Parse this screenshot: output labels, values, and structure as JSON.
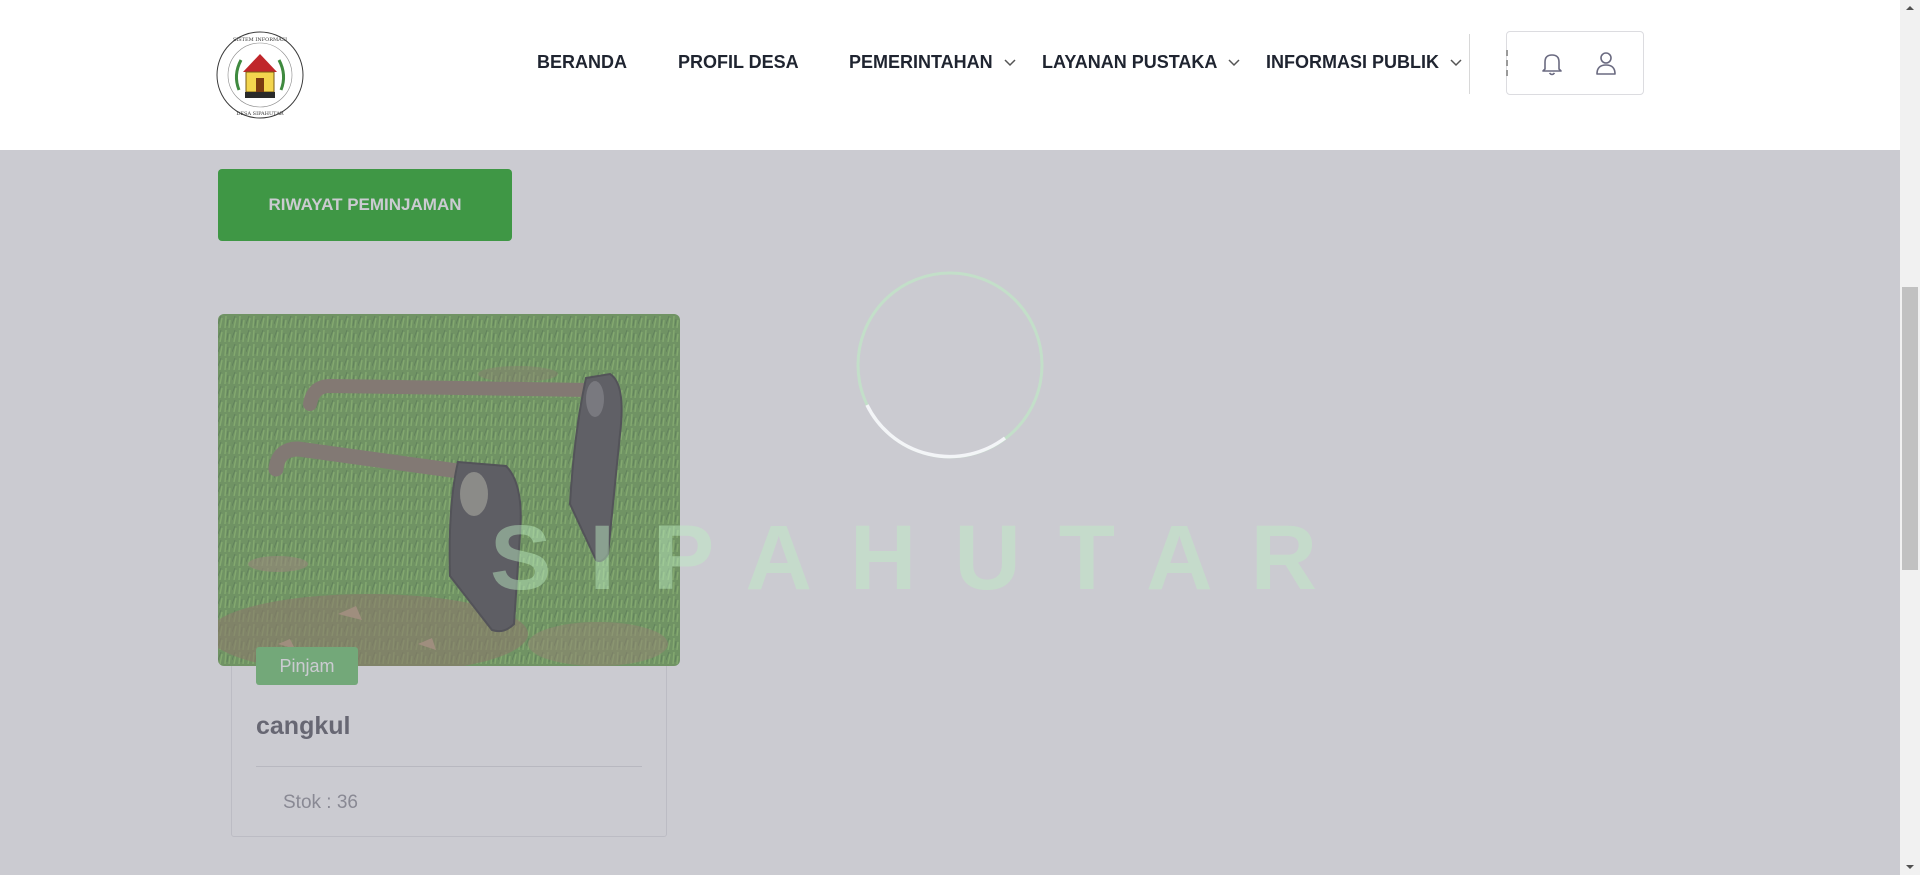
{
  "header": {
    "logo_alt": "Sistem Informasi Desa Sipahutar logo",
    "nav": [
      {
        "label": "BERANDA",
        "has_dropdown": false
      },
      {
        "label": "PROFIL DESA",
        "has_dropdown": false
      },
      {
        "label": "PEMERINTAHAN",
        "has_dropdown": true
      },
      {
        "label": "LAYANAN PUSTAKA",
        "has_dropdown": true
      },
      {
        "label": "INFORMASI PUBLIK",
        "has_dropdown": true
      }
    ],
    "icons": {
      "notifications": "bell-icon",
      "account": "user-icon"
    }
  },
  "main": {
    "history_button_label": "RIWAYAT PEMINJAMAN",
    "items": [
      {
        "name": "cangkul",
        "borrow_label": "Pinjam",
        "stock_text": "Stok : 36",
        "image_desc": "hoe tools on grass"
      }
    ]
  },
  "overlay": {
    "watermark_text": "SIPAHUTAR",
    "loading": true
  },
  "colors": {
    "primary_green": "#00a000",
    "borrow_green": "#5fbf5f",
    "nav_text": "#1f2430"
  }
}
